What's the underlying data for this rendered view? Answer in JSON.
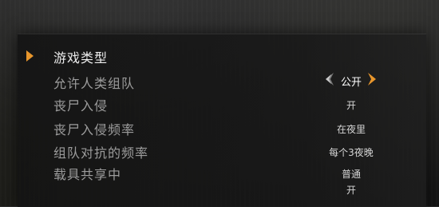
{
  "menu": {
    "items": [
      {
        "label": "游戏类型",
        "value": ""
      },
      {
        "label": "允许人类组队",
        "value": "公开"
      },
      {
        "label": "丧尸入侵",
        "value": "开"
      },
      {
        "label": "丧尸入侵频率",
        "value": "在夜里"
      },
      {
        "label": "组队对抗的频率",
        "value": "每个3夜晚"
      },
      {
        "label": "载具共享中",
        "value": "普通"
      },
      {
        "label": "",
        "value": "开"
      }
    ],
    "selected_index": 0,
    "active_index": 1
  },
  "icons": {
    "selection_marker": "triangle-right-marker-icon",
    "prev": "chevron-left-icon",
    "next": "chevron-right-icon"
  },
  "colors": {
    "accent": "#e8962c",
    "label_selected": "#ececec",
    "label_normal": "#9c9c9c",
    "value": "#d6d6d6"
  }
}
